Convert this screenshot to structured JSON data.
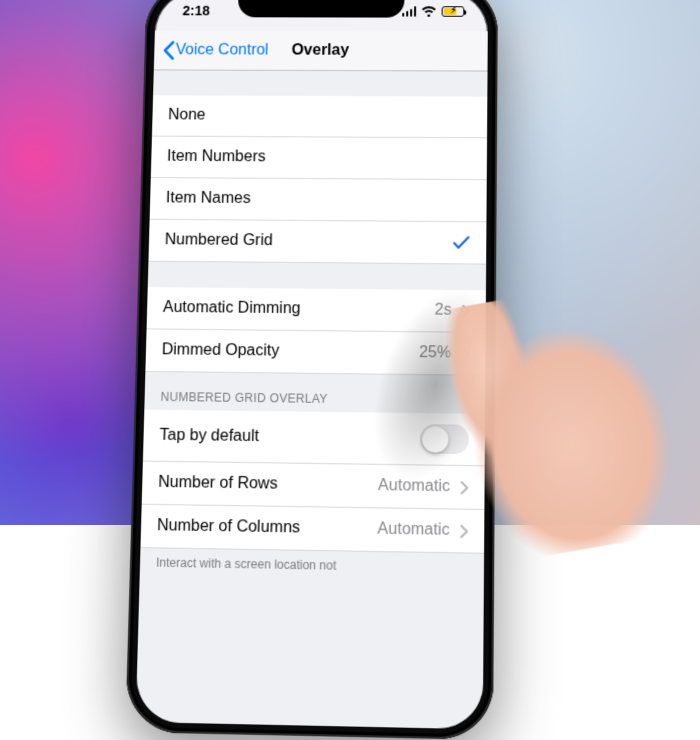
{
  "status": {
    "time": "2:18"
  },
  "nav": {
    "back_label": "Voice Control",
    "title": "Overlay"
  },
  "overlay_options": {
    "none": "None",
    "item_numbers": "Item Numbers",
    "item_names": "Item Names",
    "numbered_grid": "Numbered Grid",
    "selected": "numbered_grid"
  },
  "dimming": {
    "auto_label": "Automatic Dimming",
    "auto_value": "2s",
    "opacity_label": "Dimmed Opacity",
    "opacity_value": "25%"
  },
  "grid": {
    "header": "Numbered Grid Overlay",
    "tap_label": "Tap by default",
    "tap_on": false,
    "rows_label": "Number of Rows",
    "rows_value": "Automatic",
    "cols_label": "Number of Columns",
    "cols_value": "Automatic",
    "footer": "Interact with a screen location not"
  }
}
